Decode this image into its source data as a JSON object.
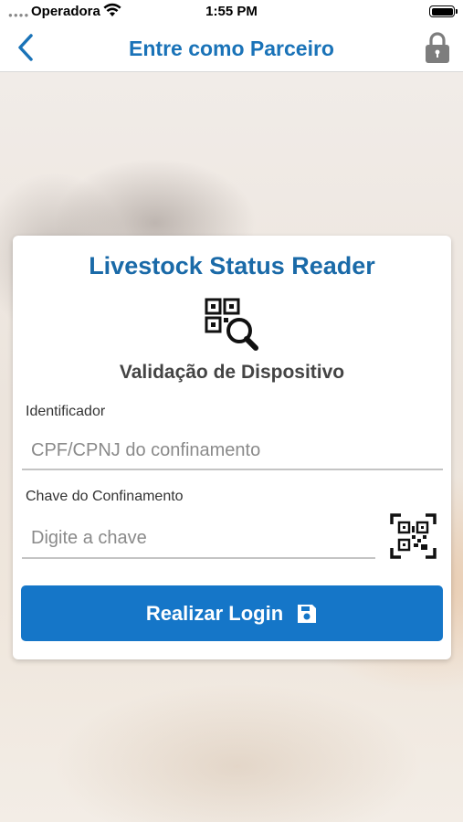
{
  "status_bar": {
    "carrier": "Operadora",
    "time": "1:55 PM"
  },
  "nav": {
    "title": "Entre como Parceiro",
    "back_icon": "chevron-left-icon",
    "lock_icon": "lock-icon"
  },
  "card": {
    "app_title": "Livestock Status Reader",
    "header_icon": "qr-search-icon",
    "subtitle": "Validação de Dispositivo",
    "identifier": {
      "label": "Identificador",
      "placeholder": "CPF/CPNJ do confinamento",
      "value": ""
    },
    "key": {
      "label": "Chave do Confinamento",
      "placeholder": "Digite a chave",
      "value": "",
      "scan_icon": "qr-scan-icon"
    },
    "login_button": {
      "label": "Realizar Login",
      "icon": "save-icon"
    }
  },
  "colors": {
    "accent": "#1a73b8",
    "button": "#1576c8"
  }
}
